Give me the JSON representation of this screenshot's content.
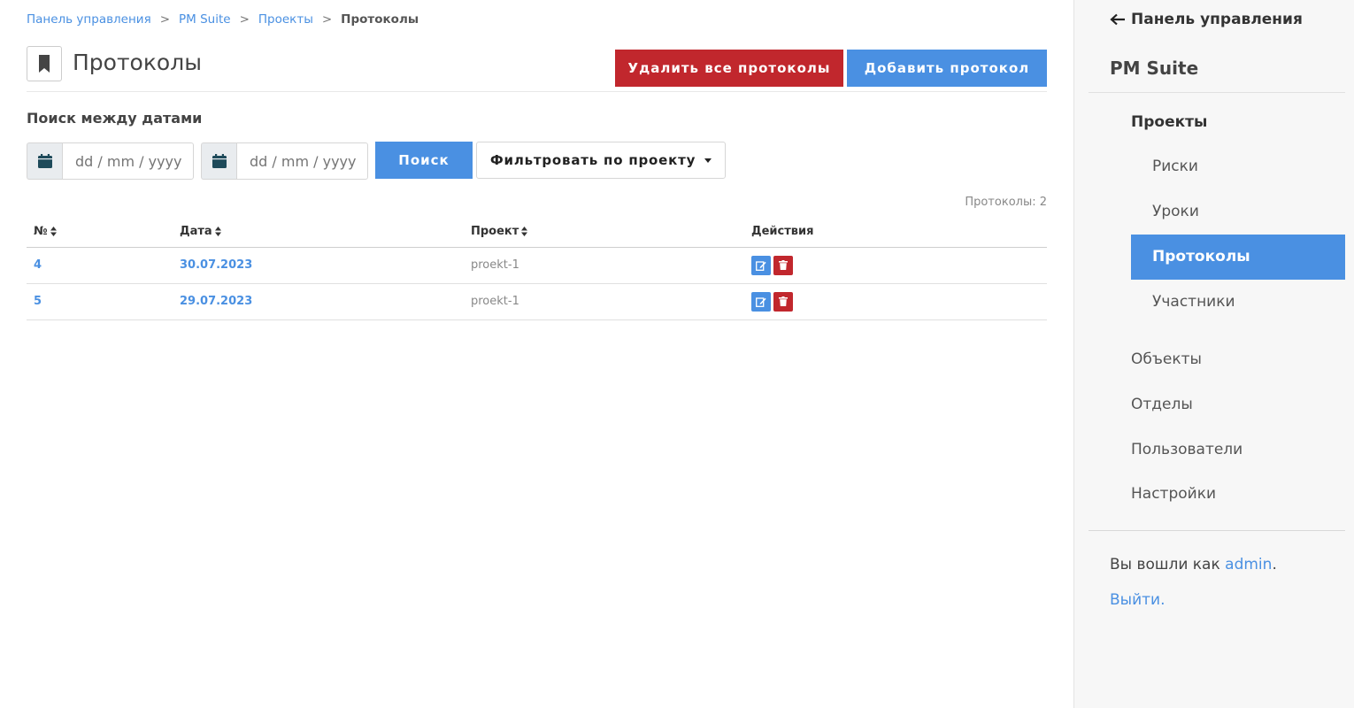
{
  "breadcrumb": {
    "items": [
      "Панель управления",
      "PM Suite",
      "Проекты"
    ],
    "separator": ">",
    "current": "Протоколы"
  },
  "header": {
    "title": "Протоколы",
    "icon": "bookmark-icon",
    "delete_all_label": "Удалить все протоколы",
    "add_label": "Добавить протокол"
  },
  "search": {
    "label": "Поиск между датами",
    "date_from_placeholder": "dd / mm / yyyy",
    "date_to_placeholder": "dd / mm / yyyy",
    "search_label": "Поиск",
    "filter_label": "Фильтровать по проекту"
  },
  "count_text": "Протоколы: 2",
  "table": {
    "headers": [
      "№",
      "Дата",
      "Проект",
      "Действия"
    ],
    "rows": [
      {
        "id": "4",
        "date": "30.07.2023",
        "project": "proekt-1"
      },
      {
        "id": "5",
        "date": "29.07.2023",
        "project": "proekt-1"
      }
    ]
  },
  "sidebar": {
    "back_label": "Панель управления",
    "app_name": "PM Suite",
    "section": "Проекты",
    "sub_items": [
      "Риски",
      "Уроки",
      "Протоколы",
      "Участники"
    ],
    "active_sub": "Протоколы",
    "items": [
      "Объекты",
      "Отделы",
      "Пользователи",
      "Настройки"
    ],
    "login_prefix": "Вы вошли как",
    "login_user": "admin",
    "login_suffix": ".",
    "logout_label": "Выйти."
  },
  "colors": {
    "primary": "#4a90e2",
    "danger": "#c1272d"
  }
}
